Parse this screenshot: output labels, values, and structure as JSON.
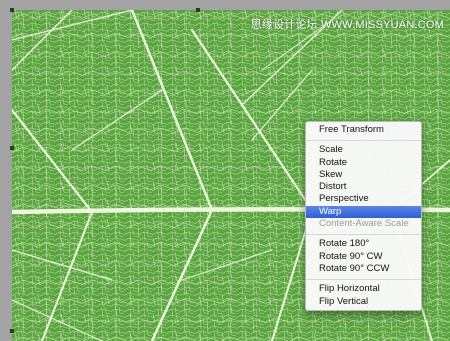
{
  "watermark": "思缘设计论坛 WWW.MISSYUAN.COM",
  "colors": {
    "leaf": "#5aa540",
    "vein": "#e9f5d6",
    "highlight": "#3a68db",
    "disabled_text": "#9a9a9a"
  },
  "context_menu": {
    "groups": [
      [
        {
          "label": "Free Transform",
          "state": "normal"
        }
      ],
      [
        {
          "label": "Scale",
          "state": "normal"
        },
        {
          "label": "Rotate",
          "state": "normal"
        },
        {
          "label": "Skew",
          "state": "normal"
        },
        {
          "label": "Distort",
          "state": "normal"
        },
        {
          "label": "Perspective",
          "state": "normal"
        },
        {
          "label": "Warp",
          "state": "selected"
        },
        {
          "label": "Content-Aware Scale",
          "state": "disabled"
        }
      ],
      [
        {
          "label": "Rotate 180°",
          "state": "normal"
        },
        {
          "label": "Rotate 90° CW",
          "state": "normal"
        },
        {
          "label": "Rotate 90° CCW",
          "state": "normal"
        }
      ],
      [
        {
          "label": "Flip Horizontal",
          "state": "normal"
        },
        {
          "label": "Flip Vertical",
          "state": "normal"
        }
      ]
    ]
  }
}
